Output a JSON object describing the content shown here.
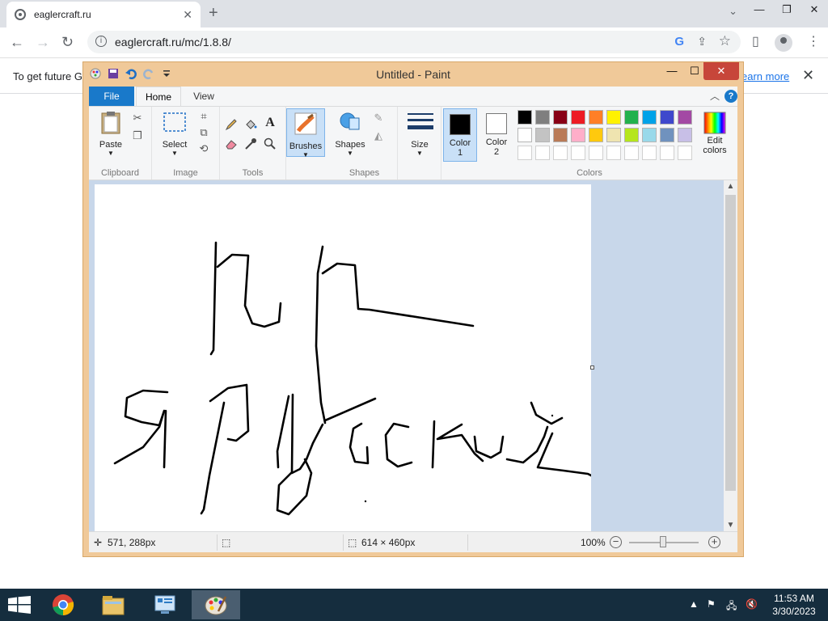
{
  "browser": {
    "tab_title": "eaglercraft.ru",
    "tab_close": "✕",
    "new_tab": "+",
    "url": "eaglercraft.ru/mc/1.8.8/",
    "window_controls": {
      "tabsearch": "⌄",
      "minimize": "—",
      "restore": "❐",
      "close": "✕"
    },
    "infobar": {
      "message": "To get future G",
      "learn_more": "earn more",
      "close": "✕"
    }
  },
  "paint": {
    "title": "Untitled - Paint",
    "controls": {
      "minimize": "—",
      "maximize": "☐",
      "close": "✕"
    },
    "ribbon_tabs": {
      "file": "File",
      "home": "Home",
      "view": "View"
    },
    "groups": {
      "clipboard": {
        "label": "Clipboard",
        "paste": "Paste"
      },
      "image": {
        "label": "Image",
        "select": "Select"
      },
      "tools": {
        "label": "Tools"
      },
      "brushes": {
        "label": "Brushes"
      },
      "shapes": {
        "label": "Shapes",
        "button": "Shapes"
      },
      "size": {
        "label": "Size"
      },
      "colors": {
        "label": "Colors",
        "color1_line1": "Color",
        "color1_line2": "1",
        "color2_line1": "Color",
        "color2_line2": "2",
        "edit_line1": "Edit",
        "edit_line2": "colors",
        "color1_value": "#000000",
        "color2_value": "#ffffff",
        "palette_row1": [
          "#000000",
          "#7f7f7f",
          "#880015",
          "#ed1c24",
          "#ff7f27",
          "#fff200",
          "#22b14c",
          "#00a2e8",
          "#3f48cc",
          "#a349a4"
        ],
        "palette_row2": [
          "#ffffff",
          "#c3c3c3",
          "#b97a57",
          "#ffaec9",
          "#ffc90e",
          "#efe4b0",
          "#b5e61d",
          "#99d9ea",
          "#7092be",
          "#c8bfe7"
        ]
      }
    },
    "status": {
      "cursor": "571, 288px",
      "canvas_size": "614 × 460px",
      "zoom": "100%"
    }
  },
  "taskbar": {
    "time": "11:53 AM",
    "date": "3/30/2023"
  }
}
